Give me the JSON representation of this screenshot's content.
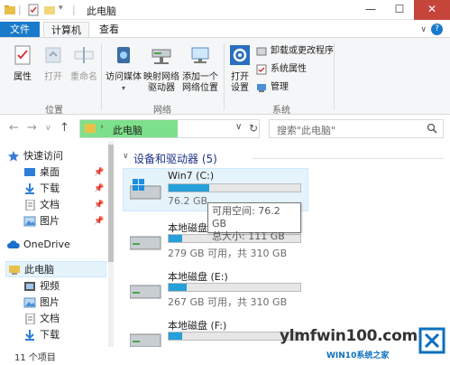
{
  "window": {
    "title": "此电脑",
    "minimize": "—",
    "maximize": "☐",
    "close": "✕"
  },
  "ribbon": {
    "tabs": [
      {
        "label": "文件"
      },
      {
        "label": "计算机"
      },
      {
        "label": "查看"
      }
    ],
    "groups": {
      "location": {
        "label": "位置",
        "buttons": [
          "属性",
          "打开",
          "重命名"
        ]
      },
      "network": {
        "label": "网络",
        "access_media": "访问媒体",
        "map_drive_line1": "映射网络",
        "map_drive_line2": "驱动器",
        "add_location_line1": "添加一个",
        "add_location_line2": "网络位置"
      },
      "system": {
        "label": "系统",
        "open_settings_line1": "打开",
        "open_settings_line2": "设置",
        "uninstall": "卸载或更改程序",
        "sys_props": "系统属性",
        "manage": "管理"
      }
    }
  },
  "address": {
    "path": "此电脑",
    "search_placeholder": "搜索\"此电脑\""
  },
  "sidebar": {
    "items": [
      {
        "label": "快速访问"
      },
      {
        "label": "桌面"
      },
      {
        "label": "下载"
      },
      {
        "label": "文档"
      },
      {
        "label": "图片"
      },
      {
        "label": "OneDrive"
      },
      {
        "label": "此电脑"
      },
      {
        "label": "视频"
      },
      {
        "label": "图片"
      },
      {
        "label": "文档"
      },
      {
        "label": "下载"
      }
    ]
  },
  "main": {
    "section_title": "设备和驱动器 (5)",
    "drives": [
      {
        "name": "Win7 (C:)",
        "size": "76.2 GB",
        "used_fraction": 0.31
      },
      {
        "name": "本地磁盘",
        "size": "279 GB 可用，共 310 GB",
        "used_fraction": 0.1
      },
      {
        "name": "本地磁盘 (E:)",
        "size": "267 GB 可用，共 310 GB",
        "used_fraction": 0.14
      },
      {
        "name": "本地磁盘 (F:)",
        "size": "",
        "used_fraction": 0.1
      }
    ],
    "tooltip": {
      "free": "可用空间: 76.2 GB",
      "total": "总大小: 111 GB"
    }
  },
  "status": {
    "count": "11 个项目"
  },
  "watermark": {
    "text": "ylmfwin100.com",
    "small": "WIN10系统之家"
  },
  "colors": {
    "accent": "#1979ca",
    "bar": "#26a0da",
    "address_highlight": "#7de08a",
    "close": "#c5453b"
  }
}
